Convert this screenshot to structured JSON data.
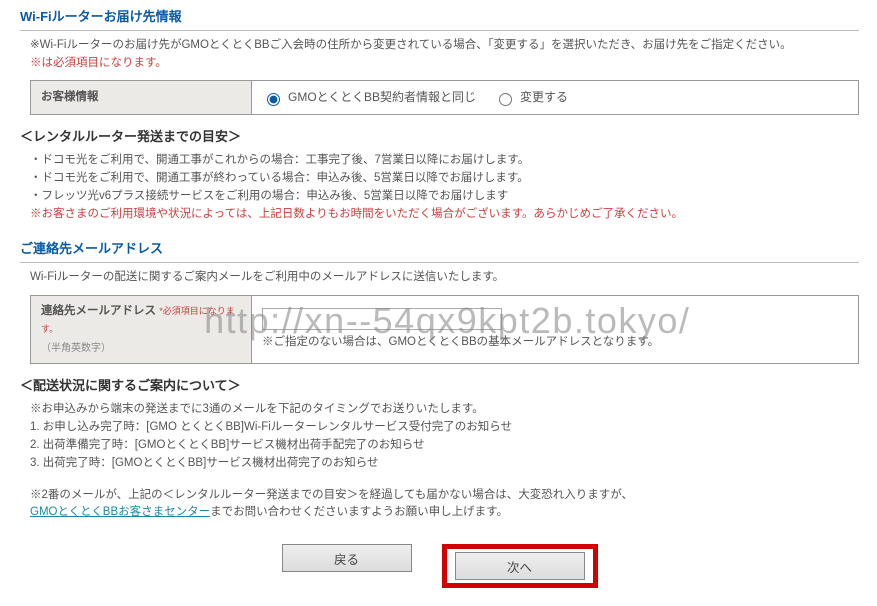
{
  "section1": {
    "heading": "Wi-Fiルーターお届け先情報",
    "note1": "※Wi-Fiルーターのお届け先がGMOとくとくBBご入会時の住所から変更されている場合、「変更する」を選択いただき、お届け先をご指定ください。",
    "note2": "※は必須項目になります。",
    "table_header": "お客様情報",
    "radio_opt1": "GMOとくとくBB契約者情報と同じ",
    "radio_opt2": "変更する"
  },
  "section2": {
    "heading": "＜レンタルルーター発送までの目安＞",
    "lines": [
      "・ドコモ光をご利用で、開通工事がこれからの場合：工事完了後、7営業日以降にお届けします。",
      "・ドコモ光をご利用で、開通工事が終わっている場合：申込み後、5営業日以降でお届けします。",
      "・フレッツ光v6プラス接続サービスをご利用の場合：申込み後、5営業日以降でお届けします"
    ],
    "warning": "※お客さまのご利用環境や状況によっては、上記日数よりもお時間をいただく場合がございます。あらかじめご了承ください。"
  },
  "section3": {
    "heading": "ご連絡先メールアドレス",
    "intro": "Wi-Fiルーターの配送に関するご案内メールをご利用中のメールアドレスに送信いたします。",
    "label": "連絡先メールアドレス",
    "label_req": "*必須項目になります。",
    "label_sub": "（半角英数字）",
    "placeholder": "",
    "input_note": "※ご指定のない場合は、GMOとくとくBBの基本メールアドレスとなります。"
  },
  "section4": {
    "heading": "＜配送状況に関するご案内について＞",
    "intro": "※お申込みから端末の発送までに3通のメールを下記のタイミングでお送りいたします。",
    "items": [
      "1. お申し込み完了時：[GMO とくとくBB]Wi-Fiルーターレンタルサービス受付完了のお知らせ",
      "2. 出荷準備完了時：[GMOとくとくBB]サービス機材出荷手配完了のお知らせ",
      "3. 出荷完了時：[GMOとくとくBB]サービス機材出荷完了のお知らせ"
    ],
    "post1a": "※2番のメールが、上記の＜レンタルルーター発送までの目安＞を経過しても届かない場合は、大変恐れ入りますが、",
    "post_link": "GMOとくとくBBお客さまセンター",
    "post1b": "までお問い合わせくださいますようお願い申し上げます。"
  },
  "buttons": {
    "back": "戻る",
    "next": "次へ"
  },
  "watermark": "http://xn--54qx9kpt2b.tokyo/"
}
